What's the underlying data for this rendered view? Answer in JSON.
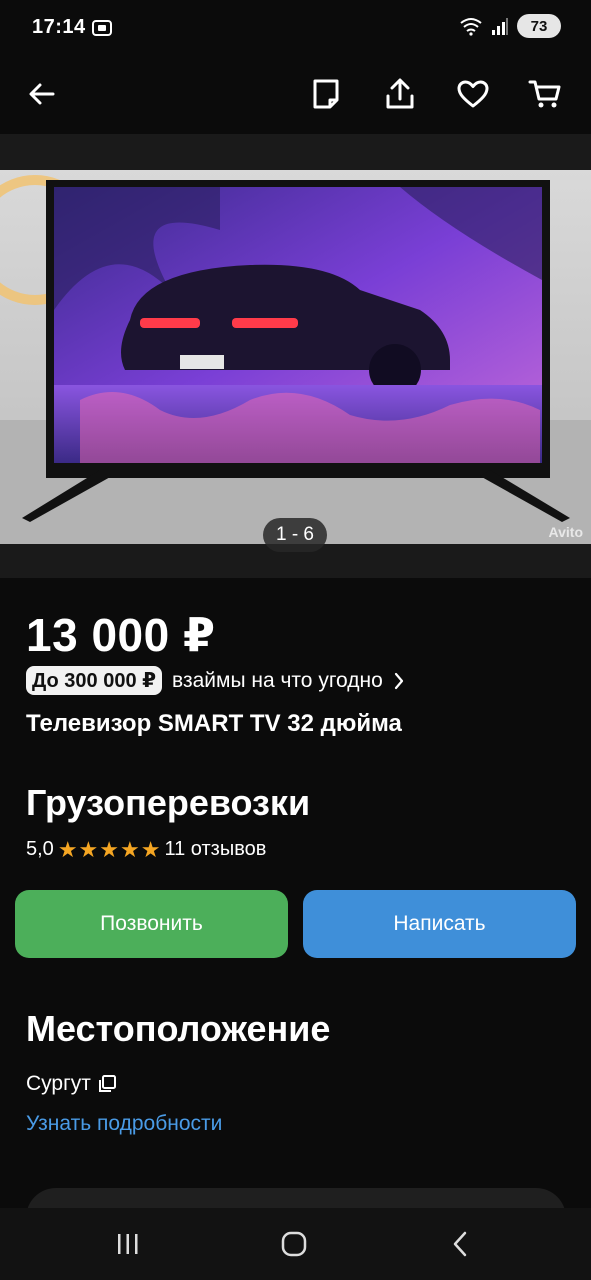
{
  "status_bar": {
    "time": "17:14",
    "battery": "73"
  },
  "header": {
    "icons": [
      "back-arrow-icon",
      "note-icon",
      "share-icon",
      "heart-icon",
      "cart-icon"
    ]
  },
  "gallery": {
    "counter": "1 - 6",
    "watermark": "Avito"
  },
  "listing": {
    "price": "13 000 ₽",
    "loan_badge": "До 300 000 ₽",
    "loan_text": "взаймы на что угодно",
    "title": "Телевизор SMART TV 32 дюйма"
  },
  "seller": {
    "name": "Грузоперевозки",
    "rating": "5,0",
    "star_count": 5,
    "reviews": "11 отзывов"
  },
  "actions": {
    "call_label": "Позвонить",
    "message_label": "Написать",
    "call_color": "#4caf5a",
    "message_color": "#3f8fd9"
  },
  "location": {
    "heading": "Местоположение",
    "city": "Сургут",
    "details_link": "Узнать подробности"
  },
  "nav": {
    "icons": [
      "recents-icon",
      "home-icon",
      "back-icon"
    ]
  }
}
